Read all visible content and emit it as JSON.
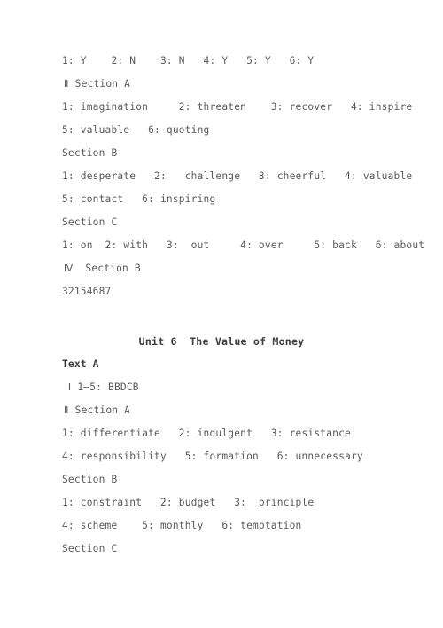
{
  "document": {
    "text_color": "#595959",
    "heading_color": "#3d3d3d",
    "background": "#ffffff",
    "blocks": [
      {
        "id": "unit5-tail",
        "lines": [
          {
            "name": "answer-line-judgement",
            "text": "1: Y    2: N    3: N   4: Y   5: Y   6: Y",
            "style": "plain"
          },
          {
            "name": "heading-section-a-2",
            "text": "Ⅱ Section A",
            "style": "roman"
          },
          {
            "name": "answer-line-section-a-1",
            "text": "1: imagination     2: threaten    3: recover   4: inspire",
            "style": "plain"
          },
          {
            "name": "answer-line-section-a-2",
            "text": "5: valuable   6: quoting",
            "style": "plain"
          },
          {
            "name": "heading-section-b-1",
            "text": "Section B",
            "style": "plain"
          },
          {
            "name": "answer-line-section-b-1",
            "text": "1: desperate   2:   challenge   3: cheerful   4: valuable",
            "style": "plain"
          },
          {
            "name": "answer-line-section-b-2",
            "text": "5: contact   6: inspiring",
            "style": "plain"
          },
          {
            "name": "heading-section-c-1",
            "text": "Section C",
            "style": "plain"
          },
          {
            "name": "answer-line-section-c-1",
            "text": "1: on  2: with   3:  out     4: over     5: back   6: about",
            "style": "plain"
          },
          {
            "name": "heading-section-b-roman-4",
            "text": "Ⅳ  Section B",
            "style": "roman"
          },
          {
            "name": "answer-line-matching",
            "text": "32154687",
            "style": "plain"
          }
        ]
      },
      {
        "id": "unit6",
        "title": "Unit 6  The Value of Money",
        "title_name": "unit-6-title",
        "lines": [
          {
            "name": "heading-text-a",
            "text": "Text A",
            "style": "bold"
          },
          {
            "name": "answer-line-reading-choice",
            "text": " Ⅰ 1–5: BBDCB",
            "style": "plain"
          },
          {
            "name": "heading-section-a-unit6",
            "text": "Ⅱ Section A",
            "style": "roman"
          },
          {
            "name": "answer-line-u6-a-1",
            "text": "1: differentiate   2: indulgent   3: resistance",
            "style": "plain"
          },
          {
            "name": "answer-line-u6-a-2",
            "text": "4: responsibility   5: formation   6: unnecessary",
            "style": "plain"
          },
          {
            "name": "heading-section-b-unit6",
            "text": "Section B",
            "style": "plain"
          },
          {
            "name": "answer-line-u6-b-1",
            "text": "1: constraint   2: budget   3:  principle",
            "style": "plain"
          },
          {
            "name": "answer-line-u6-b-2",
            "text": "4: scheme    5: monthly   6: temptation",
            "style": "plain"
          },
          {
            "name": "heading-section-c-unit6",
            "text": "Section C",
            "style": "plain"
          }
        ]
      }
    ]
  }
}
